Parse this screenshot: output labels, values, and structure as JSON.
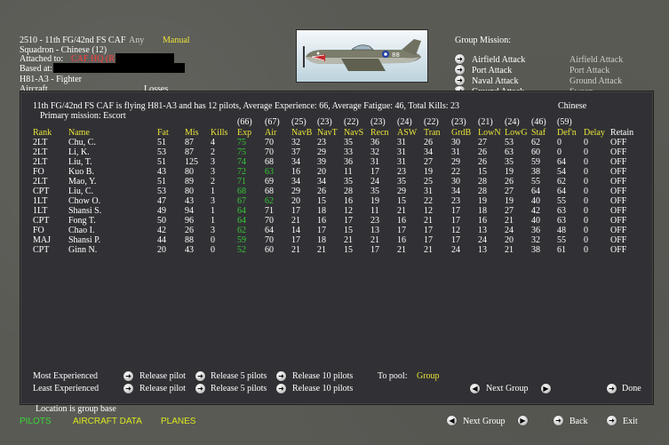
{
  "header": {
    "unit_line": "2510 - 11th FG/42nd FS CAF",
    "any_label": "Any",
    "manual_label": "Manual",
    "squadron": "Squadron - Chinese (12)",
    "attached_to_label": "Attached to:",
    "attached_to_value": "CAF HQ (R)",
    "based_at_label": "Based at:",
    "aircraft_type": "H81-A3 - Fighter",
    "aircraft_cut": "Aircraft",
    "losses_cut": "Losses"
  },
  "plane": {
    "tail_number": "88"
  },
  "group_mission": {
    "title": "Group Mission:",
    "options": [
      {
        "label": "Airfield Attack",
        "value": "Airfield Attack"
      },
      {
        "label": "Port Attack",
        "value": "Port Attack"
      },
      {
        "label": "Naval Attack",
        "value": "Ground Attack"
      },
      {
        "label": "Ground Attack",
        "value": "Sweep"
      }
    ]
  },
  "panel": {
    "summary": "11th FG/42nd FS CAF is flying H81-A3 and has 12 pilots,  Average Experience: 66,  Average Fatigue: 46,  Total Kills: 23",
    "nationality": "Chinese",
    "primary_mission": "Primary mission: Escort",
    "averages": [
      "(66)",
      "(67)",
      "(25)",
      "(23)",
      "(22)",
      "(23)",
      "(24)",
      "(22)",
      "(23)",
      "(21)",
      "(24)",
      "(46)",
      "(59)"
    ],
    "columns": [
      "Rank",
      "Name",
      "Fat",
      "Mis",
      "Kills",
      "Exp",
      "Air",
      "NavB",
      "NavT",
      "NavS",
      "Recn",
      "ASW",
      "Tran",
      "GrdB",
      "LowN",
      "LowG",
      "Staf",
      "Def'n",
      "Delay",
      "Retain"
    ],
    "pilots": [
      [
        "2LT",
        "Chu, C.",
        "51",
        "87",
        "4",
        "75",
        "70",
        "32",
        "23",
        "35",
        "36",
        "31",
        "26",
        "30",
        "27",
        "53",
        "62",
        "0",
        "OFF"
      ],
      [
        "2LT",
        "Li, K.",
        "53",
        "87",
        "2",
        "75",
        "70",
        "37",
        "29",
        "33",
        "32",
        "31",
        "34",
        "31",
        "26",
        "63",
        "60",
        "0",
        "OFF"
      ],
      [
        "2LT",
        "Liu, T.",
        "51",
        "125",
        "3",
        "74",
        "68",
        "34",
        "39",
        "36",
        "31",
        "31",
        "27",
        "29",
        "26",
        "35",
        "59",
        "64",
        "OFF"
      ],
      [
        "FO",
        "Kuo B.",
        "43",
        "80",
        "3",
        "72",
        "63",
        "16",
        "20",
        "11",
        "17",
        "23",
        "19",
        "22",
        "15",
        "19",
        "38",
        "54",
        "OFF"
      ],
      [
        "2LT",
        "Mao, Y.",
        "51",
        "89",
        "2",
        "71",
        "69",
        "34",
        "34",
        "35",
        "24",
        "35",
        "25",
        "30",
        "28",
        "26",
        "55",
        "62",
        "OFF"
      ],
      [
        "CPT",
        "Liu, C.",
        "53",
        "80",
        "1",
        "68",
        "68",
        "29",
        "26",
        "28",
        "35",
        "29",
        "31",
        "34",
        "28",
        "27",
        "64",
        "64",
        "OFF"
      ],
      [
        "1LT",
        "Chow O.",
        "47",
        "43",
        "3",
        "67",
        "62",
        "20",
        "15",
        "16",
        "19",
        "15",
        "22",
        "23",
        "19",
        "19",
        "40",
        "55",
        "OFF"
      ],
      [
        "1LT",
        "Shansi S.",
        "49",
        "94",
        "1",
        "64",
        "71",
        "17",
        "18",
        "12",
        "11",
        "21",
        "12",
        "17",
        "18",
        "27",
        "42",
        "63",
        "OFF"
      ],
      [
        "CPT",
        "Fong T.",
        "50",
        "96",
        "1",
        "64",
        "70",
        "21",
        "16",
        "17",
        "23",
        "16",
        "21",
        "17",
        "16",
        "21",
        "40",
        "63",
        "OFF"
      ],
      [
        "FO",
        "Chao I.",
        "42",
        "26",
        "3",
        "62",
        "64",
        "14",
        "17",
        "15",
        "13",
        "17",
        "17",
        "12",
        "13",
        "24",
        "36",
        "48",
        "OFF"
      ],
      [
        "MAJ",
        "Shansi P.",
        "44",
        "88",
        "0",
        "59",
        "70",
        "17",
        "18",
        "21",
        "21",
        "16",
        "17",
        "17",
        "24",
        "20",
        "32",
        "55",
        "OFF"
      ],
      [
        "CPT",
        "Ginn N.",
        "20",
        "43",
        "0",
        "52",
        "60",
        "21",
        "21",
        "15",
        "17",
        "21",
        "21",
        "24",
        "13",
        "21",
        "38",
        "61",
        "OFF"
      ]
    ],
    "delay_values": [
      "0",
      "0",
      "0",
      "0",
      "0",
      "0",
      "0",
      "0",
      "0",
      "0",
      "0",
      "0"
    ],
    "most_experienced_label": "Most Experienced",
    "least_experienced_label": "Least Experienced",
    "release_pilot": "Release pilot",
    "release_5": "Release 5 pilots",
    "release_10": "Release 10 pilots",
    "to_pool_label": "To pool:",
    "to_pool_value": "Group",
    "next_group": "Next Group",
    "done": "Done"
  },
  "footer": {
    "location": "Location is group base",
    "tab_pilots": "PILOTS",
    "tab_aircraft_data": "AIRCRAFT DATA",
    "tab_planes": "PLANES",
    "next_group": "Next Group",
    "back": "Back",
    "exit": "Exit"
  },
  "colors": {
    "text": "#ffffff",
    "highlight": "#e8e23a",
    "experience_green": "#36c836",
    "attached_red": "#ff3d3d",
    "panel_bg": "#313135",
    "screen_bg": "#5a5a55"
  }
}
